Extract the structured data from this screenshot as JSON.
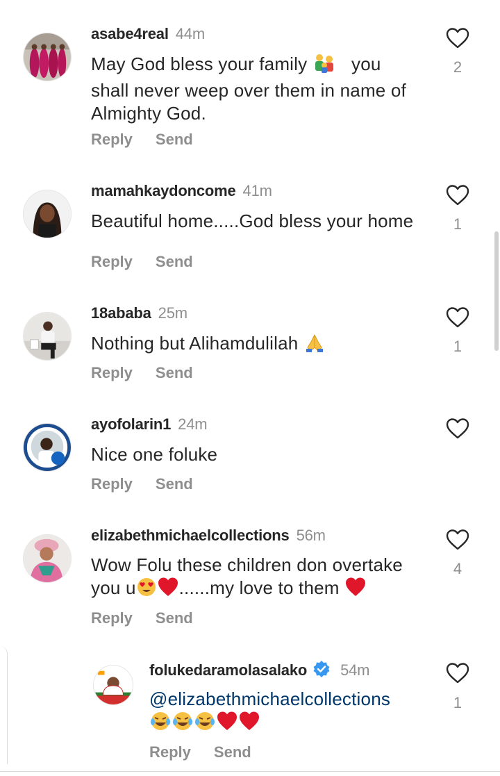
{
  "actions": {
    "reply_label": "Reply",
    "send_label": "Send"
  },
  "comments": [
    {
      "username": "asabe4real",
      "time": "44m",
      "text_lines": [
        "May God bless your family",
        "you",
        "shall never weep over them in name of",
        "Almighty God."
      ],
      "likes": "2",
      "avatar": "group-photo"
    },
    {
      "username": "mamahkaydoncome",
      "time": "41m",
      "text_lines": [
        "Beautiful home.....God bless your home"
      ],
      "likes": "1",
      "avatar": "woman-locs-photo"
    },
    {
      "username": "18ababa",
      "time": "25m",
      "text_lines": [
        "Nothing but Alihamdulilah"
      ],
      "likes": "1",
      "avatar": "man-seated-photo"
    },
    {
      "username": "ayofolarin1",
      "time": "24m",
      "text_lines": [
        "Nice one foluke"
      ],
      "likes": "",
      "avatar": "vaccine-frame-photo"
    },
    {
      "username": "elizabethmichaelcollections",
      "time": "56m",
      "text_lines": [
        "Wow Folu these children don overtake",
        "you u",
        "......my love to them"
      ],
      "likes": "4",
      "avatar": "woman-gele-photo"
    }
  ],
  "reply": {
    "username": "folukedaramolasalako",
    "verified": true,
    "time": "54m",
    "mention": "@elizabethmichaelcollections",
    "likes": "1",
    "avatar": "campaign-photo"
  },
  "icons": {
    "heart": "heart-outline-icon",
    "verified": "verified-badge-icon"
  },
  "colors": {
    "text": "#262626",
    "muted": "#8e8e8e",
    "mention": "#00376b",
    "verified": "#3897f0",
    "emoji_heart": "#e0162b"
  }
}
